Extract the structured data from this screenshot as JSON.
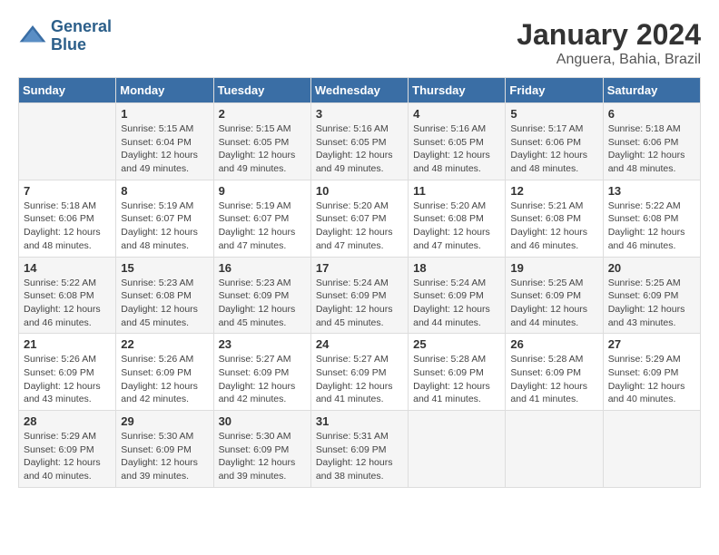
{
  "header": {
    "logo_line1": "General",
    "logo_line2": "Blue",
    "month": "January 2024",
    "location": "Anguera, Bahia, Brazil"
  },
  "weekdays": [
    "Sunday",
    "Monday",
    "Tuesday",
    "Wednesday",
    "Thursday",
    "Friday",
    "Saturday"
  ],
  "weeks": [
    [
      {
        "day": "",
        "sunrise": "",
        "sunset": "",
        "daylight": ""
      },
      {
        "day": "1",
        "sunrise": "Sunrise: 5:15 AM",
        "sunset": "Sunset: 6:04 PM",
        "daylight": "Daylight: 12 hours and 49 minutes."
      },
      {
        "day": "2",
        "sunrise": "Sunrise: 5:15 AM",
        "sunset": "Sunset: 6:05 PM",
        "daylight": "Daylight: 12 hours and 49 minutes."
      },
      {
        "day": "3",
        "sunrise": "Sunrise: 5:16 AM",
        "sunset": "Sunset: 6:05 PM",
        "daylight": "Daylight: 12 hours and 49 minutes."
      },
      {
        "day": "4",
        "sunrise": "Sunrise: 5:16 AM",
        "sunset": "Sunset: 6:05 PM",
        "daylight": "Daylight: 12 hours and 48 minutes."
      },
      {
        "day": "5",
        "sunrise": "Sunrise: 5:17 AM",
        "sunset": "Sunset: 6:06 PM",
        "daylight": "Daylight: 12 hours and 48 minutes."
      },
      {
        "day": "6",
        "sunrise": "Sunrise: 5:18 AM",
        "sunset": "Sunset: 6:06 PM",
        "daylight": "Daylight: 12 hours and 48 minutes."
      }
    ],
    [
      {
        "day": "7",
        "sunrise": "Sunrise: 5:18 AM",
        "sunset": "Sunset: 6:06 PM",
        "daylight": "Daylight: 12 hours and 48 minutes."
      },
      {
        "day": "8",
        "sunrise": "Sunrise: 5:19 AM",
        "sunset": "Sunset: 6:07 PM",
        "daylight": "Daylight: 12 hours and 48 minutes."
      },
      {
        "day": "9",
        "sunrise": "Sunrise: 5:19 AM",
        "sunset": "Sunset: 6:07 PM",
        "daylight": "Daylight: 12 hours and 47 minutes."
      },
      {
        "day": "10",
        "sunrise": "Sunrise: 5:20 AM",
        "sunset": "Sunset: 6:07 PM",
        "daylight": "Daylight: 12 hours and 47 minutes."
      },
      {
        "day": "11",
        "sunrise": "Sunrise: 5:20 AM",
        "sunset": "Sunset: 6:08 PM",
        "daylight": "Daylight: 12 hours and 47 minutes."
      },
      {
        "day": "12",
        "sunrise": "Sunrise: 5:21 AM",
        "sunset": "Sunset: 6:08 PM",
        "daylight": "Daylight: 12 hours and 46 minutes."
      },
      {
        "day": "13",
        "sunrise": "Sunrise: 5:22 AM",
        "sunset": "Sunset: 6:08 PM",
        "daylight": "Daylight: 12 hours and 46 minutes."
      }
    ],
    [
      {
        "day": "14",
        "sunrise": "Sunrise: 5:22 AM",
        "sunset": "Sunset: 6:08 PM",
        "daylight": "Daylight: 12 hours and 46 minutes."
      },
      {
        "day": "15",
        "sunrise": "Sunrise: 5:23 AM",
        "sunset": "Sunset: 6:08 PM",
        "daylight": "Daylight: 12 hours and 45 minutes."
      },
      {
        "day": "16",
        "sunrise": "Sunrise: 5:23 AM",
        "sunset": "Sunset: 6:09 PM",
        "daylight": "Daylight: 12 hours and 45 minutes."
      },
      {
        "day": "17",
        "sunrise": "Sunrise: 5:24 AM",
        "sunset": "Sunset: 6:09 PM",
        "daylight": "Daylight: 12 hours and 45 minutes."
      },
      {
        "day": "18",
        "sunrise": "Sunrise: 5:24 AM",
        "sunset": "Sunset: 6:09 PM",
        "daylight": "Daylight: 12 hours and 44 minutes."
      },
      {
        "day": "19",
        "sunrise": "Sunrise: 5:25 AM",
        "sunset": "Sunset: 6:09 PM",
        "daylight": "Daylight: 12 hours and 44 minutes."
      },
      {
        "day": "20",
        "sunrise": "Sunrise: 5:25 AM",
        "sunset": "Sunset: 6:09 PM",
        "daylight": "Daylight: 12 hours and 43 minutes."
      }
    ],
    [
      {
        "day": "21",
        "sunrise": "Sunrise: 5:26 AM",
        "sunset": "Sunset: 6:09 PM",
        "daylight": "Daylight: 12 hours and 43 minutes."
      },
      {
        "day": "22",
        "sunrise": "Sunrise: 5:26 AM",
        "sunset": "Sunset: 6:09 PM",
        "daylight": "Daylight: 12 hours and 42 minutes."
      },
      {
        "day": "23",
        "sunrise": "Sunrise: 5:27 AM",
        "sunset": "Sunset: 6:09 PM",
        "daylight": "Daylight: 12 hours and 42 minutes."
      },
      {
        "day": "24",
        "sunrise": "Sunrise: 5:27 AM",
        "sunset": "Sunset: 6:09 PM",
        "daylight": "Daylight: 12 hours and 41 minutes."
      },
      {
        "day": "25",
        "sunrise": "Sunrise: 5:28 AM",
        "sunset": "Sunset: 6:09 PM",
        "daylight": "Daylight: 12 hours and 41 minutes."
      },
      {
        "day": "26",
        "sunrise": "Sunrise: 5:28 AM",
        "sunset": "Sunset: 6:09 PM",
        "daylight": "Daylight: 12 hours and 41 minutes."
      },
      {
        "day": "27",
        "sunrise": "Sunrise: 5:29 AM",
        "sunset": "Sunset: 6:09 PM",
        "daylight": "Daylight: 12 hours and 40 minutes."
      }
    ],
    [
      {
        "day": "28",
        "sunrise": "Sunrise: 5:29 AM",
        "sunset": "Sunset: 6:09 PM",
        "daylight": "Daylight: 12 hours and 40 minutes."
      },
      {
        "day": "29",
        "sunrise": "Sunrise: 5:30 AM",
        "sunset": "Sunset: 6:09 PM",
        "daylight": "Daylight: 12 hours and 39 minutes."
      },
      {
        "day": "30",
        "sunrise": "Sunrise: 5:30 AM",
        "sunset": "Sunset: 6:09 PM",
        "daylight": "Daylight: 12 hours and 39 minutes."
      },
      {
        "day": "31",
        "sunrise": "Sunrise: 5:31 AM",
        "sunset": "Sunset: 6:09 PM",
        "daylight": "Daylight: 12 hours and 38 minutes."
      },
      {
        "day": "",
        "sunrise": "",
        "sunset": "",
        "daylight": ""
      },
      {
        "day": "",
        "sunrise": "",
        "sunset": "",
        "daylight": ""
      },
      {
        "day": "",
        "sunrise": "",
        "sunset": "",
        "daylight": ""
      }
    ]
  ]
}
